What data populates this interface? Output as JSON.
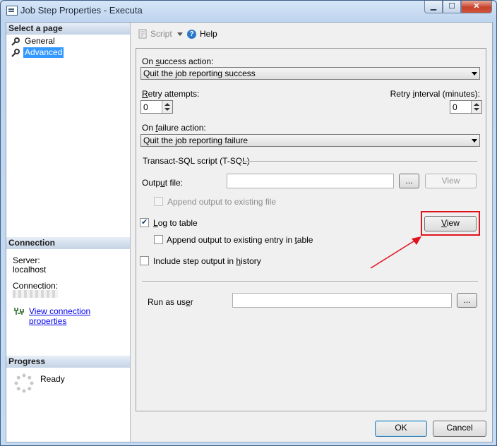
{
  "window": {
    "title": "Job Step Properties - Executa",
    "min": "▁",
    "max": "☐",
    "close": "✕"
  },
  "left": {
    "select_page": "Select a page",
    "pages": [
      {
        "label": "General",
        "icon": "wrench-icon"
      },
      {
        "label": "Advanced",
        "icon": "wrench-icon"
      }
    ],
    "connection_header": "Connection",
    "server_label": "Server:",
    "server_value": "localhost",
    "connection_label": "Connection:",
    "view_connection": "View connection properties",
    "progress_header": "Progress",
    "progress_status": "Ready"
  },
  "toolbar": {
    "script": "Script",
    "help": "Help"
  },
  "form": {
    "on_success_label": "On success action:",
    "on_success_value": "Quit the job reporting success",
    "retry_attempts_label": "Retry attempts:",
    "retry_attempts_value": "0",
    "retry_interval_label": "Retry interval (minutes):",
    "retry_interval_value": "0",
    "on_failure_label": "On failure action:",
    "on_failure_value": "Quit the job reporting failure",
    "tsql_group": "Transact-SQL script (T-SQL)",
    "output_file_label": "Output file:",
    "browse": "...",
    "view_disabled": "View",
    "append_output": "Append output to existing file",
    "log_to_table": "Log to table",
    "log_to_table_checked": true,
    "view": "View",
    "append_entry": "Append output to existing entry in table",
    "include_history": "Include step output in history",
    "run_as_user": "Run as user",
    "browse2": "..."
  },
  "footer": {
    "ok": "OK",
    "cancel": "Cancel"
  },
  "colors": {
    "highlight": "#e0141e",
    "selection": "#3399ff",
    "link": "#0000ee"
  }
}
